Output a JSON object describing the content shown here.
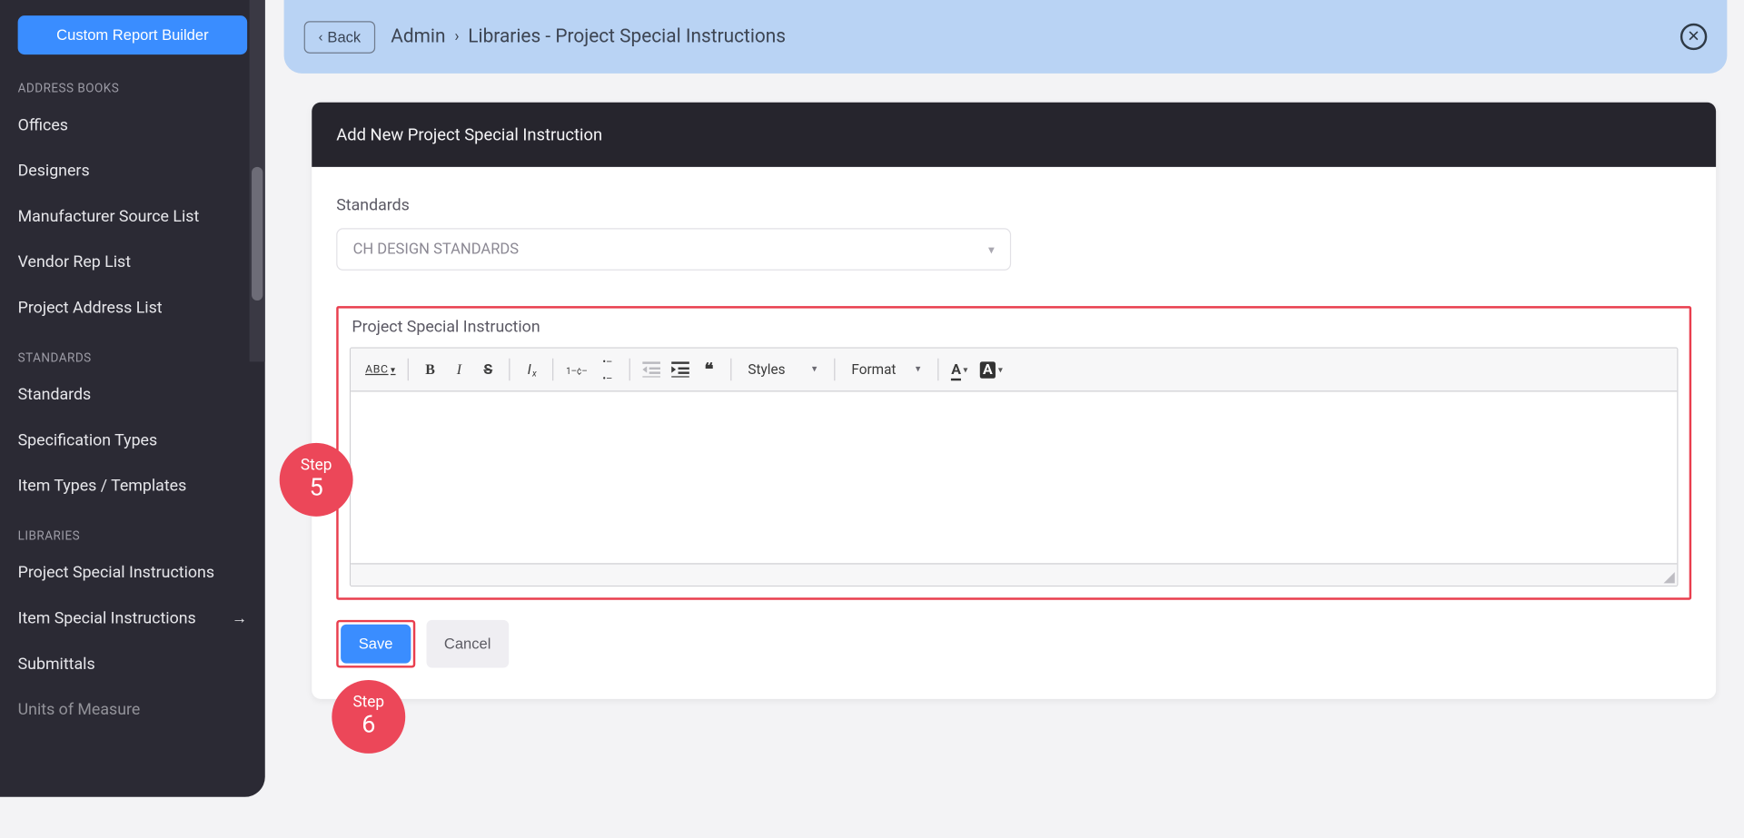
{
  "sidebar": {
    "primary_button": "Custom Report Builder",
    "sections": [
      {
        "title": "ADDRESS BOOKS",
        "items": [
          {
            "label": "Offices"
          },
          {
            "label": "Designers"
          },
          {
            "label": "Manufacturer Source List"
          },
          {
            "label": "Vendor Rep List"
          },
          {
            "label": "Project Address List"
          }
        ]
      },
      {
        "title": "STANDARDS",
        "items": [
          {
            "label": "Standards"
          },
          {
            "label": "Specification Types"
          },
          {
            "label": "Item Types / Templates"
          }
        ]
      },
      {
        "title": "LIBRARIES",
        "items": [
          {
            "label": "Project Special Instructions"
          },
          {
            "label": "Item Special Instructions",
            "has_arrow": true
          },
          {
            "label": "Submittals"
          },
          {
            "label": "Units of Measure"
          }
        ]
      }
    ]
  },
  "topbar": {
    "back_label": "Back",
    "crumb1": "Admin",
    "crumb2": "Libraries - Project Special Instructions"
  },
  "card": {
    "title": "Add New Project Special Instruction",
    "standards_label": "Standards",
    "standards_value": "CH DESIGN STANDARDS",
    "editor_label": "Project Special Instruction"
  },
  "toolbar": {
    "spellcheck": "ABC",
    "styles": "Styles",
    "format": "Format"
  },
  "actions": {
    "save": "Save",
    "cancel": "Cancel"
  },
  "steps": {
    "s5_label": "Step",
    "s5_num": "5",
    "s6_label": "Step",
    "s6_num": "6"
  }
}
